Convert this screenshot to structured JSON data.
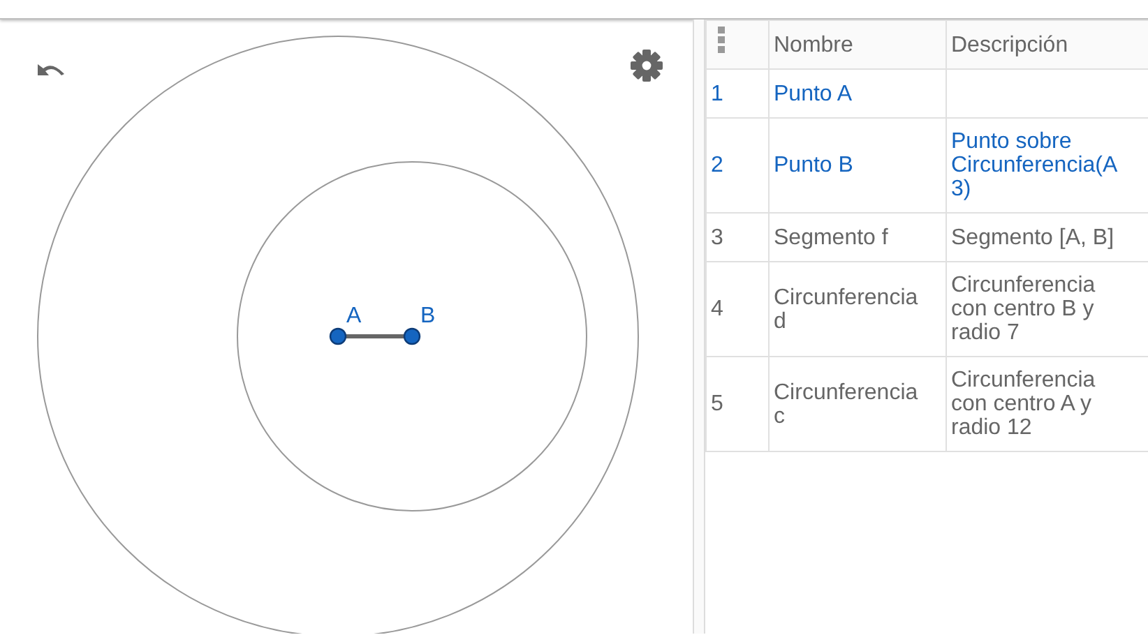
{
  "graphics": {
    "points": [
      {
        "label": "A"
      },
      {
        "label": "B"
      }
    ]
  },
  "algebra_table": {
    "columns": [
      "Nombre",
      "Descripción"
    ],
    "rows": [
      {
        "index": "1",
        "name": "Punto A",
        "color": "#1565c0"
      },
      {
        "index": "2",
        "name": "Punto B",
        "description": "Punto sobre Circunferencia(A 3)",
        "color": "#1565c0"
      },
      {
        "index": "3",
        "name": "Segmento f",
        "description": "Segmento [A, B]",
        "color": "#666666"
      },
      {
        "index": "4",
        "name": "Circunferencia d",
        "description": "Circunferencia con centro B y radio 7",
        "color": "#666666"
      },
      {
        "index": "5",
        "name": "Circunferencia c",
        "description": "Circunferencia con centro A y radio 12",
        "color": "#666666"
      }
    ]
  }
}
